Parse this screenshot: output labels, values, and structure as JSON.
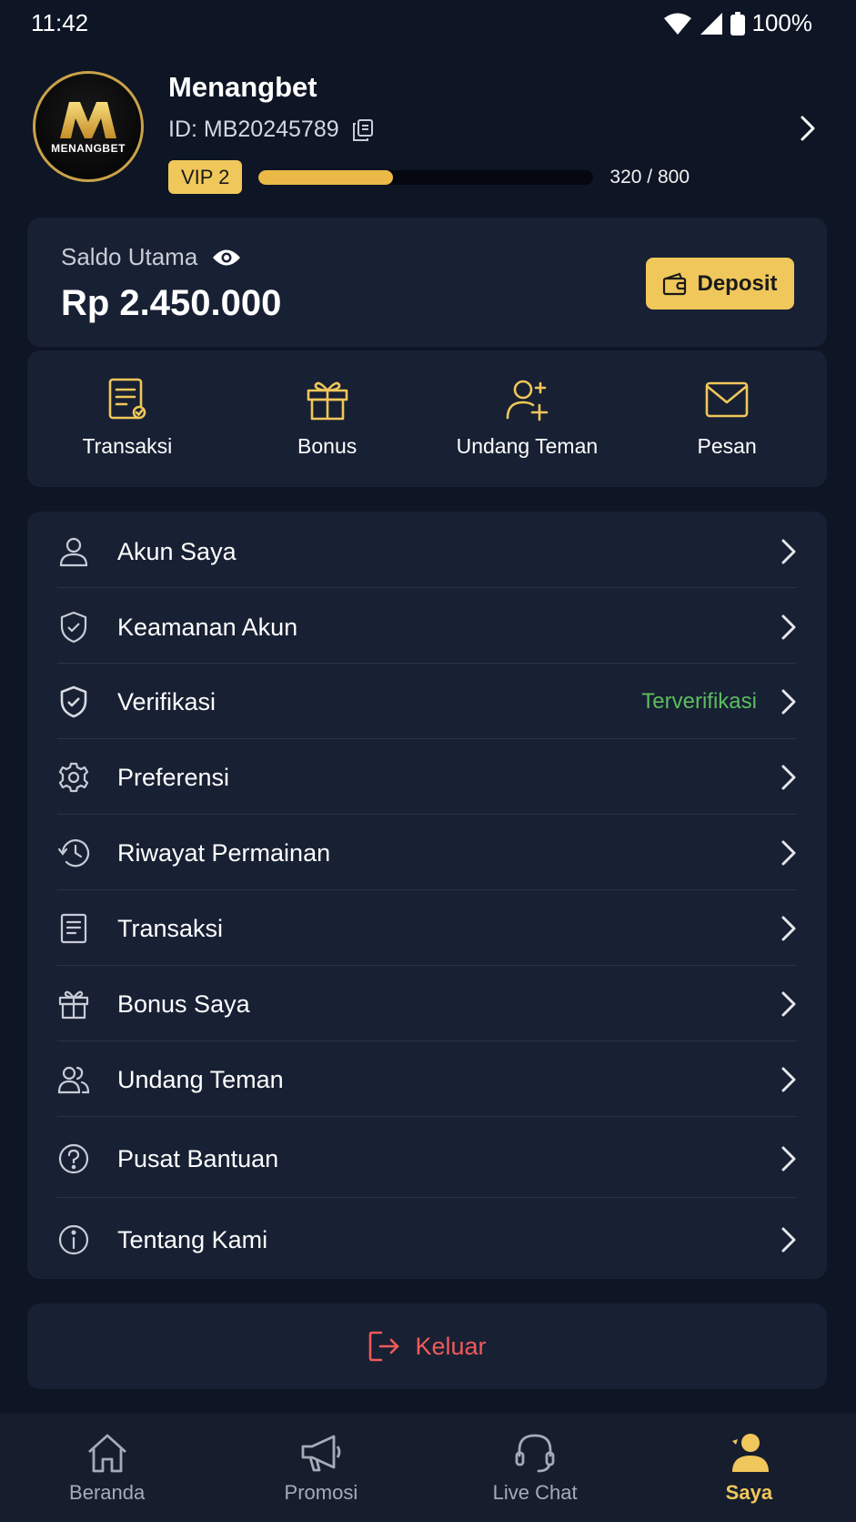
{
  "status_bar": {
    "time": "11:42",
    "battery": "100%"
  },
  "profile": {
    "logo_letter": "M",
    "logo_text": "MENANGBET",
    "name": "Menangbet",
    "id": "ID: MB20245789",
    "vip_label": "VIP 2",
    "vip_progress": 0.4,
    "vip_count": "320 / 800"
  },
  "balance": {
    "label": "Saldo Utama",
    "amount": "Rp 2.450.000",
    "deposit_label": "Deposit"
  },
  "quick_actions": [
    {
      "label": "Transaksi",
      "icon": "receipt-icon"
    },
    {
      "label": "Bonus",
      "icon": "gift-icon"
    },
    {
      "label": "Undang Teman",
      "icon": "user-plus-icon"
    },
    {
      "label": "Pesan",
      "icon": "mail-icon"
    }
  ],
  "menu": [
    {
      "label": "Akun Saya",
      "icon": "user-icon",
      "status": ""
    },
    {
      "label": "Keamanan Akun",
      "icon": "shield-icon",
      "status": ""
    },
    {
      "label": "Verifikasi",
      "icon": "shield-check-icon",
      "status": "Terverifikasi"
    },
    {
      "label": "Preferensi",
      "icon": "gear-icon",
      "status": ""
    },
    {
      "label": "Riwayat Permainan",
      "icon": "history-icon",
      "status": ""
    },
    {
      "label": "Transaksi",
      "icon": "document-icon",
      "status": ""
    },
    {
      "label": "Bonus Saya",
      "icon": "gift-icon",
      "status": ""
    },
    {
      "label": "Undang Teman",
      "icon": "users-icon",
      "status": ""
    },
    {
      "label": "Pusat Bantuan",
      "icon": "help-icon",
      "status": ""
    },
    {
      "label": "Tentang Kami",
      "icon": "info-icon",
      "status": ""
    }
  ],
  "logout": {
    "label": "Keluar"
  },
  "bottom_nav": [
    {
      "label": "Beranda",
      "icon": "home-icon",
      "active": false
    },
    {
      "label": "Promosi",
      "icon": "megaphone-icon",
      "active": false
    },
    {
      "label": "Live Chat",
      "icon": "headset-icon",
      "active": false
    },
    {
      "label": "Saya",
      "icon": "profile-icon",
      "active": true
    }
  ],
  "colors": {
    "background": "#0e1524",
    "card": "#182033",
    "accent": "#f0c75a",
    "verified": "#5bbd5f",
    "logout": "#f05a5a"
  }
}
